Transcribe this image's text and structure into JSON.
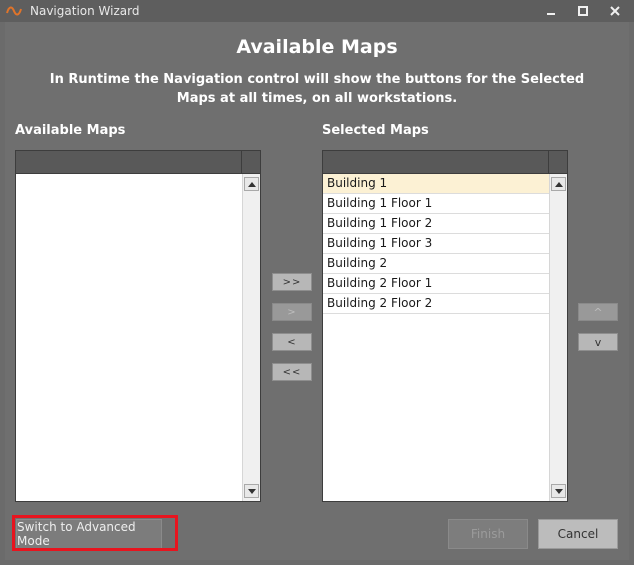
{
  "window": {
    "title": "Navigation Wizard",
    "icon": "wave-logo-icon"
  },
  "heading": "Available Maps",
  "subtitle": "In Runtime the Navigation control will show the buttons for the Selected Maps at all times, on all workstations.",
  "available": {
    "label": "Available Maps",
    "items": []
  },
  "selected": {
    "label": "Selected Maps",
    "items": [
      "Building 1",
      "Building 1 Floor 1",
      "Building 1 Floor 2",
      "Building 1 Floor 3",
      "Building 2",
      "Building 2 Floor 1",
      "Building 2 Floor 2"
    ],
    "selected_index": 0
  },
  "move_buttons": {
    "add_all": ">>",
    "add": ">",
    "remove": "<",
    "remove_all": "<<"
  },
  "order_buttons": {
    "up": "^",
    "down": "v"
  },
  "footer": {
    "advanced": "Switch to Advanced Mode",
    "finish": "Finish",
    "cancel": "Cancel"
  },
  "colors": {
    "background": "#6f6f6f",
    "selection": "#fcf1d4",
    "highlight": "#e8141e"
  }
}
